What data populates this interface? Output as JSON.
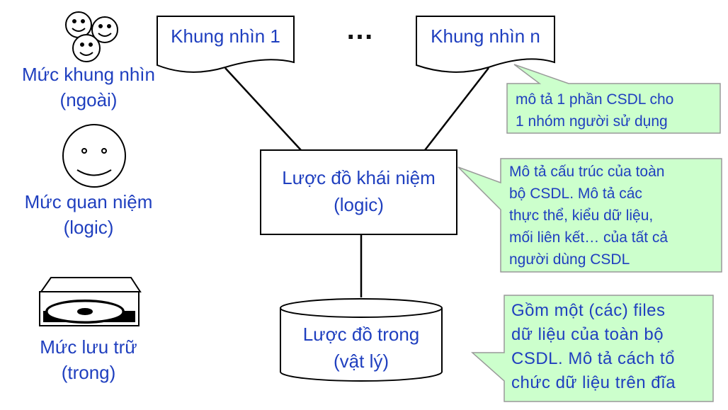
{
  "levels": {
    "external": {
      "line1": "Mức khung nhìn",
      "line2": "(ngoài)",
      "icon": "group-faces-icon"
    },
    "conceptual": {
      "line1": "Mức quan niệm",
      "line2": "(logic)",
      "icon": "smiley-face-icon"
    },
    "internal": {
      "line1": "Mức lưu trữ",
      "line2": "(trong)",
      "icon": "disk-drive-icon"
    }
  },
  "views": {
    "first": "Khung nhìn 1",
    "ellipsis": "…",
    "last": "Khung nhìn n"
  },
  "conceptual_schema": {
    "line1": "Lược đồ khái niệm",
    "line2": "(logic)"
  },
  "internal_schema": {
    "line1": "Lược đồ trong",
    "line2": "(vật lý)"
  },
  "notes": {
    "views_note": "mô tả 1 phần CSDL cho\n1 nhóm người sử dụng",
    "conceptual_note": "Mô tả cấu trúc của toàn\nbộ CSDL. Mô tả các\nthực thể, kiểu dữ liệu,\nmối liên kết… của tất cả\nngười dùng CSDL",
    "internal_note": "Gồm một (các) files\ndữ liệu của toàn bộ\nCSDL. Mô tả cách tổ\nchức dữ liệu trên đĩa"
  },
  "colors": {
    "text": "#1f3fbf",
    "note_fill": "#ccffcc",
    "outline": "#000000"
  }
}
